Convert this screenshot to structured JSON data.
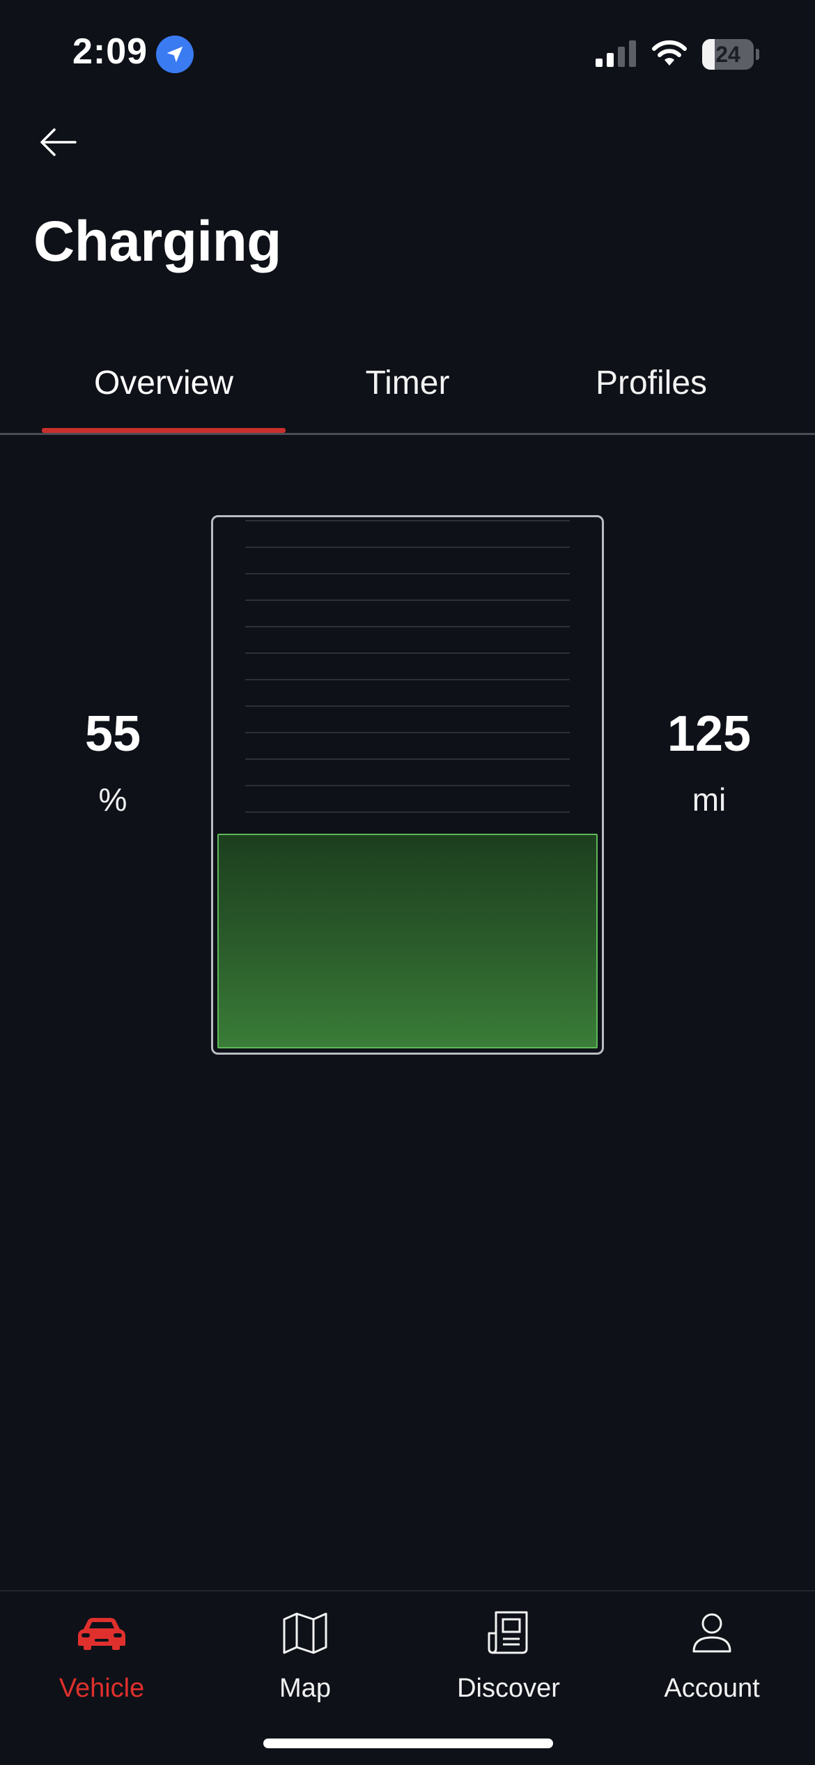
{
  "status_bar": {
    "time": "2:09",
    "battery_percent": "24",
    "battery_level": 0.24
  },
  "header": {
    "title": "Charging",
    "back_icon": "arrow-left-icon"
  },
  "tabs": [
    {
      "label": "Overview",
      "active": true
    },
    {
      "label": "Timer",
      "active": false
    },
    {
      "label": "Profiles",
      "active": false
    }
  ],
  "charge": {
    "percent_value": "55",
    "percent_unit": "%",
    "range_value": "125",
    "range_unit": "mi",
    "level": 0.55
  },
  "bottom_nav": [
    {
      "label": "Vehicle",
      "icon": "car-icon",
      "active": true
    },
    {
      "label": "Map",
      "icon": "map-icon",
      "active": false
    },
    {
      "label": "Discover",
      "icon": "news-icon",
      "active": false
    },
    {
      "label": "Account",
      "icon": "user-icon",
      "active": false
    }
  ],
  "colors": {
    "background": "#0e1118",
    "accent": "#c8302d",
    "active_nav": "#e0302d",
    "charge_green": "#5fb85a",
    "location_blue": "#3a7bf2"
  }
}
